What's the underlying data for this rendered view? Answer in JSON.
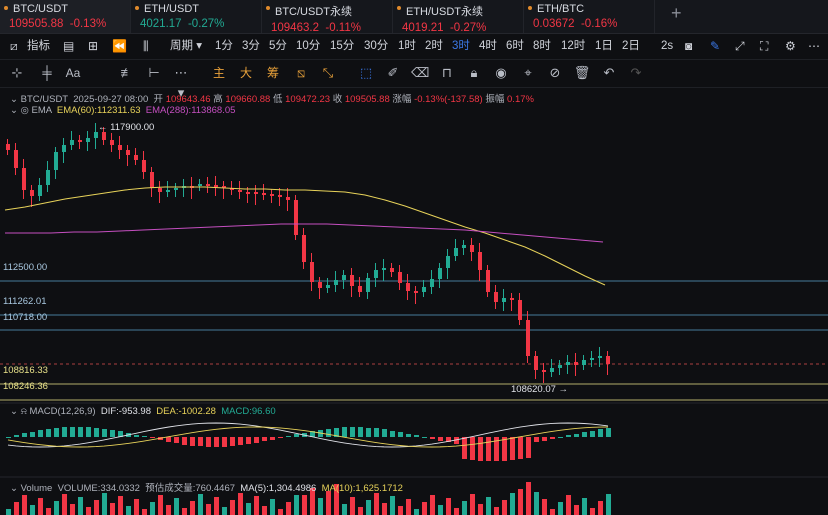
{
  "tabs": [
    {
      "name": "BTC/USDT",
      "price": "109505.88",
      "change": "-0.13%",
      "dir": "down",
      "active": true
    },
    {
      "name": "ETH/USDT",
      "price": "4021.17",
      "change": "-0.27%",
      "dir": "up"
    },
    {
      "name": "BTC/USDT永续",
      "price": "109463.2",
      "change": "-0.11%",
      "dir": "down"
    },
    {
      "name": "ETH/USDT永续",
      "price": "4019.21",
      "change": "-0.27%",
      "dir": "down"
    },
    {
      "name": "ETH/BTC",
      "price": "0.03672",
      "change": "-0.16%",
      "dir": "down"
    }
  ],
  "toolbar": {
    "indicator": "指标",
    "period": "周期",
    "intervals": [
      "1分",
      "3分",
      "5分",
      "10分",
      "15分",
      "30分",
      "1时",
      "2时",
      "3时",
      "4时",
      "6时",
      "8时",
      "12时",
      "1日",
      "2日"
    ],
    "selected": "3时",
    "speed": "2s"
  },
  "draw_tools": {
    "main": "主",
    "large": "大",
    "chips": "筹"
  },
  "ohlc": {
    "symbol": "BTC/USDT",
    "date": "2025-09-27 08:00",
    "open_label": "开",
    "open": "109643.46",
    "high_label": "高",
    "high": "109660.88",
    "low_label": "低",
    "low": "109472.23",
    "close_label": "收",
    "close": "109505.88",
    "chg_label": "涨幅",
    "chg": "-0.13%(-137.58)",
    "amp_label": "振幅",
    "amp": "0.17%"
  },
  "ema": {
    "title": "EMA",
    "ema60": "EMA(60):112311.63",
    "ema288": "EMA(288):113868.05"
  },
  "annotations": {
    "high": "← 117900.00",
    "low": "108620.07 →"
  },
  "levels": {
    "l1": "112500.00",
    "l2": "111262.01",
    "l3": "110718.00",
    "l4": "108816.33",
    "l5": "108246.36"
  },
  "macd": {
    "title": "MACD(12,26,9)",
    "dif": "DIF:-953.98",
    "dea": "DEA:-1002.28",
    "macd": "MACD:96.60"
  },
  "volume": {
    "title": "Volume",
    "vol": "VOLUME:334.0332",
    "est": "预估成交量:760.4467",
    "ma5": "MA(5):1,304.4986",
    "ma10": "MA(10):1,625.1712"
  },
  "colors": {
    "up": "#22ab94",
    "down": "#f23645",
    "ema60": "#e8d35a",
    "ema288": "#c54fc0",
    "accent": "#3b78e7"
  }
}
